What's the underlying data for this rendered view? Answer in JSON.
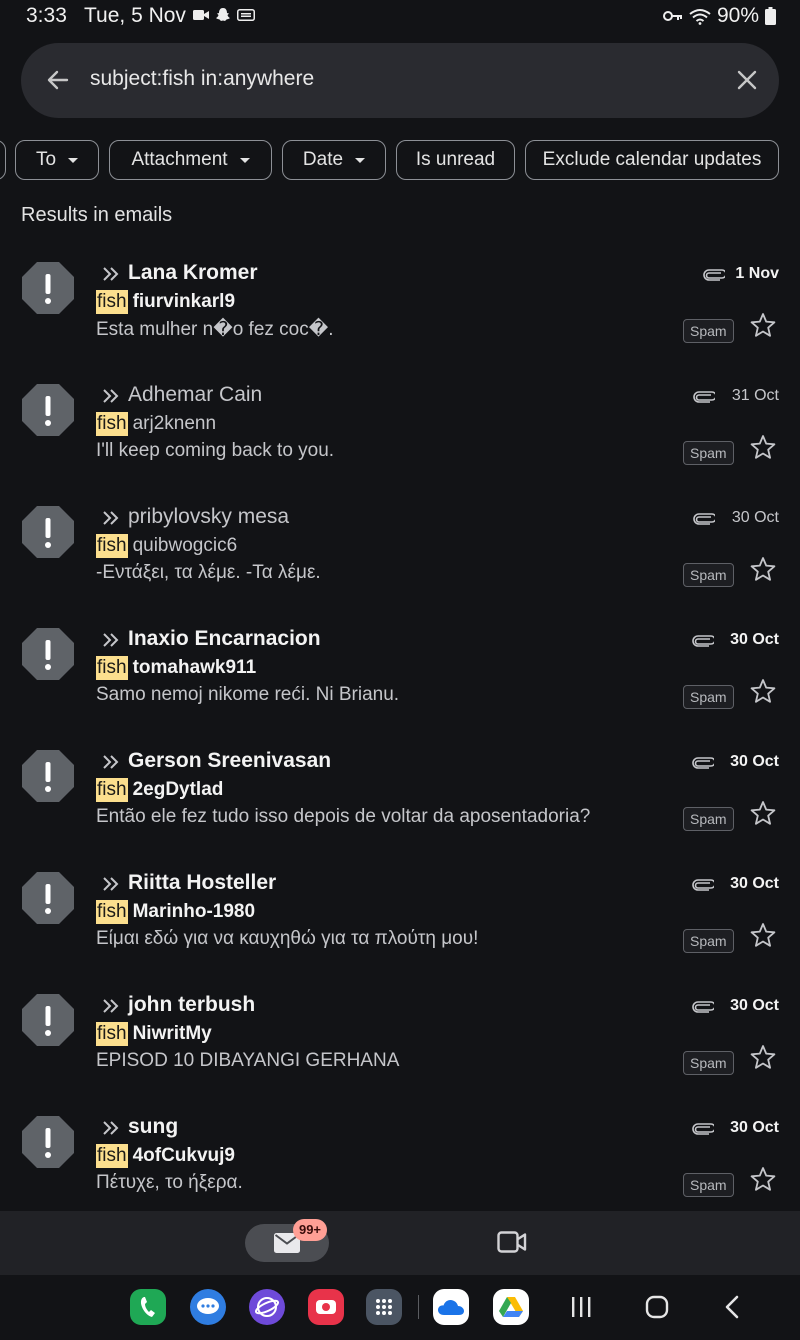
{
  "status_bar": {
    "time": "3:33",
    "date": "Tue, 5 Nov",
    "battery": "90%",
    "icons_left": [
      "video-icon",
      "snapchat-icon",
      "cast-icon"
    ],
    "icons_right": [
      "key-icon",
      "wifi-icon",
      "battery-icon"
    ]
  },
  "search": {
    "query": "subject:fish in:anywhere",
    "back_icon": "back-arrow-icon",
    "clear_icon": "close-icon"
  },
  "filters": {
    "chips": [
      {
        "label": "To",
        "dropdown": true
      },
      {
        "label": "Attachment",
        "dropdown": true
      },
      {
        "label": "Date",
        "dropdown": true
      },
      {
        "label": "Is unread",
        "dropdown": false
      },
      {
        "label": "Exclude calendar updates",
        "dropdown": false
      }
    ]
  },
  "results": {
    "title": "Results in emails",
    "spam_label": "Spam",
    "highlight_word": "fish",
    "emails": [
      {
        "sender": "Lana Kromer",
        "date": "1 Nov",
        "subject": "fiurvinkarl9",
        "snippet": "Esta mulher n�o fez coc�.",
        "unread": true
      },
      {
        "sender": "Adhemar Cain",
        "date": "31 Oct",
        "subject": "arj2knenn",
        "snippet": "I'll keep coming back to you.",
        "unread": false
      },
      {
        "sender": "pribylovsky mesa",
        "date": "30 Oct",
        "subject": "quibwogcic6",
        "snippet": "-Εντάξει, τα λέμε. -Τα λέμε.",
        "unread": false
      },
      {
        "sender": "Inaxio Encarnacion",
        "date": "30 Oct",
        "subject": "tomahawk911",
        "snippet": "Samo nemoj nikome reći. Ni Brianu.",
        "unread": true
      },
      {
        "sender": "Gerson Sreenivasan",
        "date": "30 Oct",
        "subject": "2egDytlad",
        "snippet": "Então ele fez tudo isso depois de voltar da aposentadoria?",
        "unread": true
      },
      {
        "sender": "Riitta Hosteller",
        "date": "30 Oct",
        "subject": "Marinho-1980",
        "snippet": "Είμαι εδώ για να καυχηθώ για τα πλούτη μου!",
        "unread": true
      },
      {
        "sender": "john terbush",
        "date": "30 Oct",
        "subject": "NiwritMy",
        "snippet": "EPISOD 10 DIBAYANGI GERHANA",
        "unread": true
      },
      {
        "sender": "sung",
        "date": "30 Oct",
        "subject": "4ofCukvuj9",
        "snippet": "Πέτυχε, το ήξερα.",
        "unread": true
      }
    ]
  },
  "bottom_bar": {
    "mail_badge": "99+",
    "items": [
      "mail-icon",
      "video-camera-icon"
    ]
  },
  "nav_bar": {
    "apps": [
      "phone-app-icon",
      "messages-app-icon",
      "internet-app-icon",
      "screen-recorder-app-icon",
      "apps-grid-icon",
      "onedrive-app-icon",
      "drive-app-icon"
    ],
    "buttons": [
      "recents-button",
      "home-button",
      "back-button"
    ]
  },
  "colors": {
    "background": "#121316",
    "search_bar": "#2a2b30",
    "highlight": "#fcdf8e",
    "badge": "#ff9f95"
  }
}
